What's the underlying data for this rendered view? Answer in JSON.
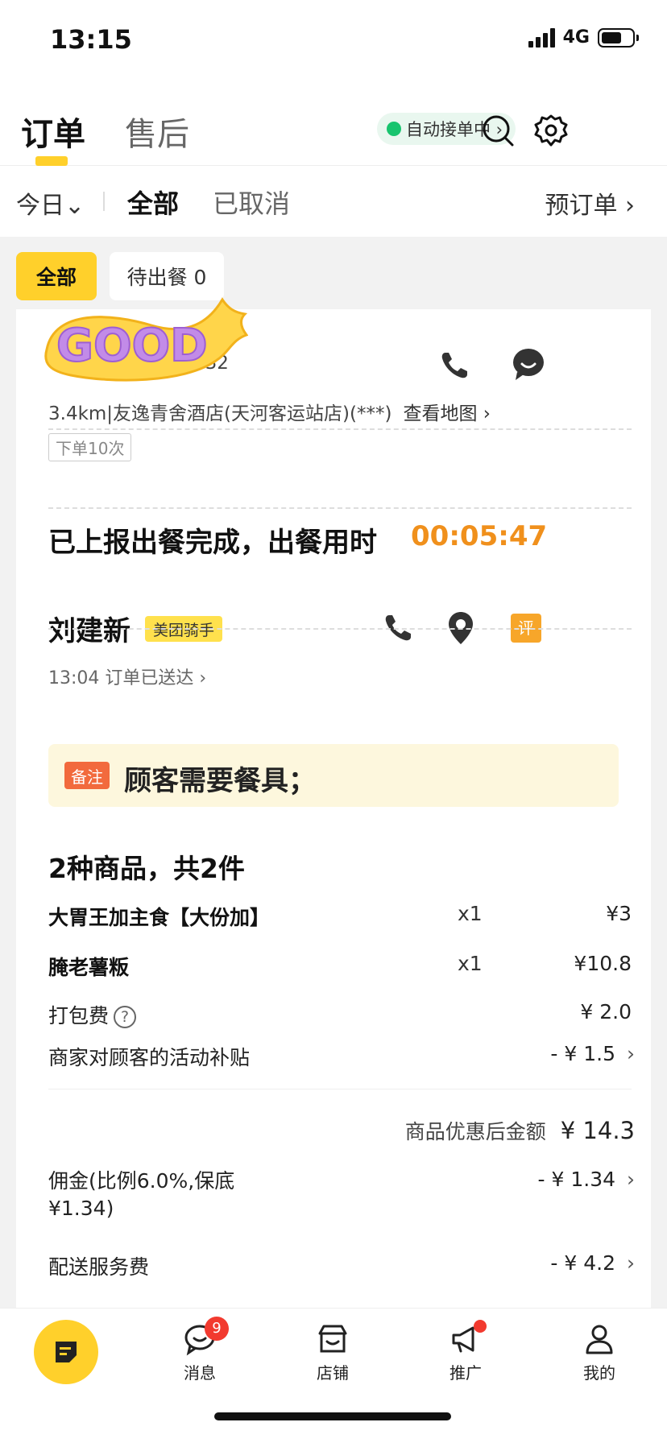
{
  "status_bar": {
    "time": "13:15",
    "network": "4G"
  },
  "header": {
    "tabs": [
      {
        "label": "订单"
      },
      {
        "label": "售后"
      }
    ],
    "auto_accept": "自动接单中 ›"
  },
  "filters": {
    "today": "今日⌄",
    "all": "全部",
    "cancelled": "已取消",
    "preorder": "预订单 ›"
  },
  "chips": {
    "all": "全部",
    "waiting": "待出餐 0"
  },
  "order": {
    "phone_partial": "332",
    "address": "3.4km|友逸青舍酒店(天河客运站店)(***)",
    "map_link": "查看地图 ›",
    "order_count_tag": "下单10次",
    "meal_report": "已上报出餐完成，出餐用时",
    "meal_time": "00:05:47",
    "rider": {
      "name": "刘建新",
      "badge": "美团骑手",
      "status": "13:04  订单已送达 ›",
      "review_label": "评"
    },
    "note": {
      "tag": "备注",
      "text": "顾客需要餐具；"
    },
    "goods_title": "2种商品，共2件",
    "items": [
      {
        "name": "大胃王加主食【大份加】",
        "qty": "x1",
        "price": "¥3"
      },
      {
        "name": "腌老薯粄",
        "qty": "x1",
        "price": "¥10.8"
      }
    ],
    "fees": [
      {
        "name": "打包费",
        "value": "¥ 2.0"
      },
      {
        "name": "商家对顾客的活动补贴",
        "value": "- ¥ 1.5"
      }
    ],
    "subtotal_label": "商品优惠后金额",
    "subtotal_value": "¥ 14.3",
    "commission": {
      "label_line1": "佣金(比例6.0%,保底",
      "label_line2": "¥1.34)",
      "value": "- ¥ 1.34"
    },
    "delivery_fee": {
      "label": "配送服务费",
      "value": "- ¥ 4.2"
    }
  },
  "bottom_nav": [
    {
      "label": "消息",
      "badge": "9"
    },
    {
      "label": "店铺"
    },
    {
      "label": "推广"
    },
    {
      "label": "我的"
    }
  ],
  "sticker_text": "GOOD",
  "colors": {
    "accent": "#ffd02b",
    "orange": "#f0901c",
    "green": "#18c46e",
    "red": "#f23a2f"
  }
}
